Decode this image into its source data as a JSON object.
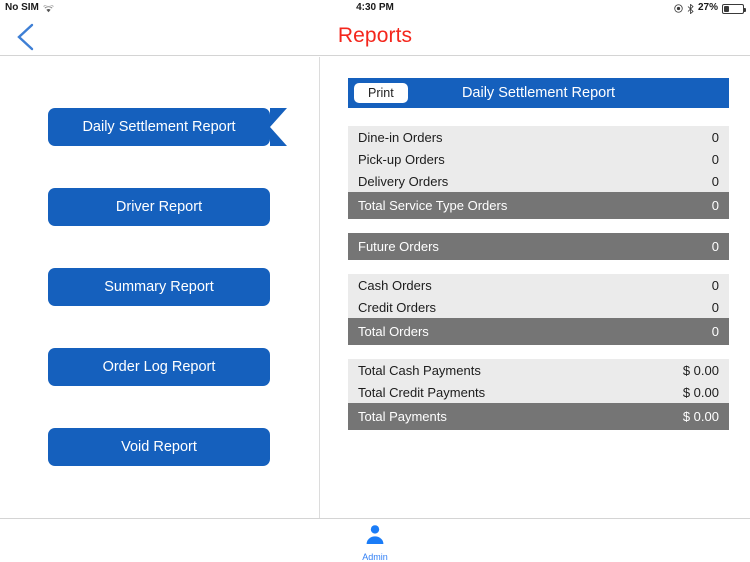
{
  "status_bar": {
    "carrier": "No SIM",
    "wifi_icon": "wifi-icon",
    "time": "4:30 PM",
    "rotation_lock_icon": "rotation-lock-icon",
    "bluetooth_icon": "bluetooth-icon",
    "battery_percent": "27%",
    "battery_icon": "battery-icon"
  },
  "nav": {
    "back_icon": "back-chevron-icon",
    "title": "Reports"
  },
  "menu": {
    "items": [
      {
        "label": "Daily Settlement Report",
        "selected": true
      },
      {
        "label": "Driver Report",
        "selected": false
      },
      {
        "label": "Summary Report",
        "selected": false
      },
      {
        "label": "Order Log Report",
        "selected": false
      },
      {
        "label": "Void Report",
        "selected": false
      }
    ]
  },
  "report": {
    "print_label": "Print",
    "title": "Daily Settlement Report",
    "sections": [
      {
        "rows": [
          {
            "label": "Dine-in Orders",
            "value": "0",
            "total": false
          },
          {
            "label": "Pick-up Orders",
            "value": "0",
            "total": false
          },
          {
            "label": "Delivery Orders",
            "value": "0",
            "total": false
          },
          {
            "label": "Total Service Type Orders",
            "value": "0",
            "total": true
          }
        ]
      },
      {
        "rows": [
          {
            "label": "Future Orders",
            "value": "0",
            "total": true
          }
        ]
      },
      {
        "rows": [
          {
            "label": "Cash Orders",
            "value": "0",
            "total": false
          },
          {
            "label": "Credit Orders",
            "value": "0",
            "total": false
          },
          {
            "label": "Total Orders",
            "value": "0",
            "total": true
          }
        ]
      },
      {
        "rows": [
          {
            "label": "Total Cash Payments",
            "value": "$ 0.00",
            "total": false
          },
          {
            "label": "Total Credit Payments",
            "value": "$ 0.00",
            "total": false
          },
          {
            "label": "Total Payments",
            "value": "$ 0.00",
            "total": true
          }
        ]
      }
    ]
  },
  "tabbar": {
    "items": [
      {
        "label": "Admin",
        "icon": "person-icon"
      }
    ]
  },
  "colors": {
    "brand_blue": "#1560bd",
    "title_red": "#f4261c",
    "row_light": "#ebebeb",
    "row_total": "#757575",
    "tab_blue": "#2f7ef5"
  }
}
